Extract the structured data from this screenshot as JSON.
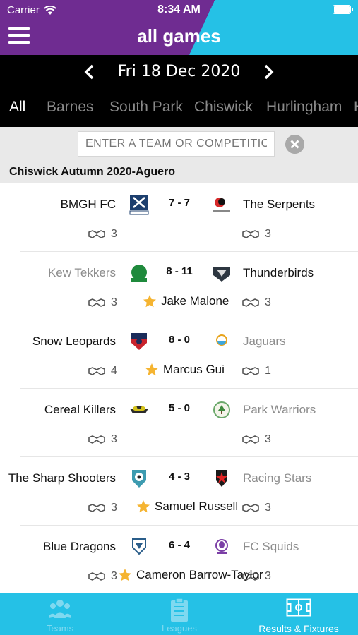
{
  "status": {
    "carrier": "Carrier",
    "time": "8:34 AM"
  },
  "header": {
    "title": "all games"
  },
  "date_nav": {
    "date": "Fri 18 Dec 2020"
  },
  "tabs": [
    "All",
    "Barnes",
    "South Park",
    "Chiswick",
    "Hurlingham",
    "H"
  ],
  "search": {
    "placeholder": "ENTER A TEAM OR COMPETITION"
  },
  "section": {
    "title": "Chiswick Autumn 2020-Aguero"
  },
  "matches": [
    {
      "home": "BMGH FC",
      "away": "The Serpents",
      "score": "7 - 7",
      "home_hs": "3",
      "away_hs": "3",
      "mvp": ""
    },
    {
      "home": "Kew Tekkers",
      "away": "Thunderbirds",
      "score": "8 - 11",
      "home_hs": "3",
      "away_hs": "3",
      "mvp": "Jake Malone"
    },
    {
      "home": "Snow Leopards",
      "away": "Jaguars",
      "score": "8 - 0",
      "home_hs": "4",
      "away_hs": "1",
      "mvp": "Marcus Gui"
    },
    {
      "home": "Cereal Killers",
      "away": "Park Warriors",
      "score": "5 - 0",
      "home_hs": "3",
      "away_hs": "3",
      "mvp": ""
    },
    {
      "home": "The Sharp Shooters",
      "away": "Racing Stars",
      "score": "4 - 3",
      "home_hs": "3",
      "away_hs": "3",
      "mvp": "Samuel Russell"
    },
    {
      "home": "Blue Dragons",
      "away": "FC Squids",
      "score": "6 - 4",
      "home_hs": "3",
      "away_hs": "3",
      "mvp": "Cameron Barrow-Taylor"
    }
  ],
  "bottom_nav": {
    "teams": "Teams",
    "leagues": "Leagues",
    "results": "Results & Fixtures"
  },
  "colors": {
    "purple": "#6f2c91",
    "cyan": "#25c1e6",
    "star": "#f5b431"
  }
}
